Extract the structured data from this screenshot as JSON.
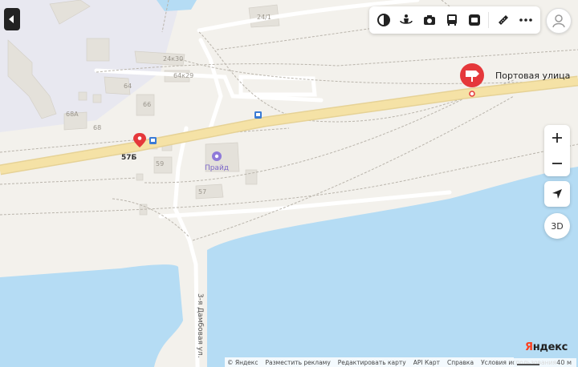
{
  "map": {
    "place_name": "Портовая улица",
    "marker_address": "57Б",
    "street_label": "3-я Дамбовая ул.",
    "poi_name": "Прайд",
    "buildings": [
      "24/1",
      "24к30",
      "64к29",
      "64",
      "66",
      "68А",
      "68",
      "59",
      "57"
    ],
    "colors": {
      "water": "#b5dcf4",
      "land": "#f3f1ec",
      "road": "#f2dea0",
      "railway": "#b9b4ab",
      "marker": "#e5383b",
      "building": "#e6e3dc",
      "industrial": "#e7e7ef"
    }
  },
  "controls": {
    "sidebar_toggle_icon": "chevron-left-icon",
    "toolbar_icons": [
      "layers-icon",
      "panorama-icon",
      "photo-icon",
      "transit-icon",
      "traffic-icon",
      "ruler-icon",
      "more-icon"
    ],
    "zoom_in": "+",
    "zoom_out": "−",
    "locate_icon": "locate-arrow-icon",
    "mode_3d": "3D"
  },
  "brand": {
    "logo": "Яндекс"
  },
  "scale": {
    "label": "40 м"
  },
  "footer": {
    "links": [
      "© Яндекс",
      "Разместить рекламу",
      "Редактировать карту",
      "API Карт",
      "Справка",
      "Условия использования"
    ]
  }
}
